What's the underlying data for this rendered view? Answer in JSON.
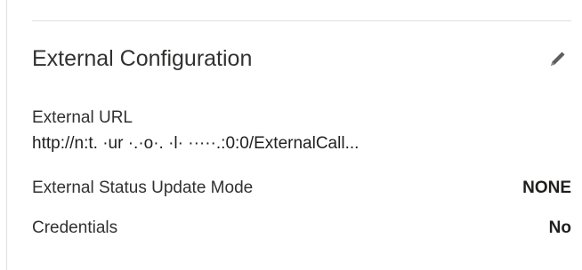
{
  "panel": {
    "title": "External Configuration",
    "edit_icon": "pencil-icon"
  },
  "fields": {
    "external_url": {
      "label": "External URL",
      "value": "http://n:t.   ·ur          ·.·o·. ·l·  ·····.:0:0/ExternalCall..."
    },
    "status_update_mode": {
      "label": "External Status Update Mode",
      "value": "NONE"
    },
    "credentials": {
      "label": "Credentials",
      "value": "No"
    }
  },
  "colors": {
    "text": "#323130",
    "divider": "#e1dfdd",
    "icon": "#605e5c"
  }
}
